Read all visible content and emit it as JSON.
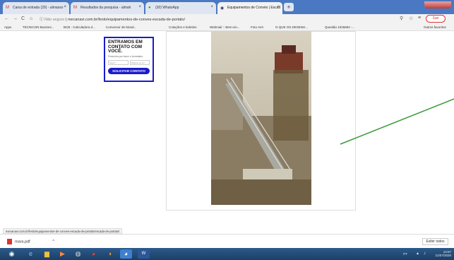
{
  "tabs": [
    {
      "label": "Caixa de entrada (29) - almasso",
      "icon": "gmail-icon"
    },
    {
      "label": "Resultados da pesquisa - almah",
      "icon": "gmail-icon"
    },
    {
      "label": "(30) WhatsApp",
      "icon": "whatsapp-icon"
    },
    {
      "label": "Equipamentos de Convés | Escad",
      "icon": "site-icon"
    }
  ],
  "address": {
    "security": "Não seguro",
    "url": "mecanavi.com.br/feslo/equipamentos-de-conves-escada-de-portalo/"
  },
  "sair_label": "Sair",
  "bookmarks": [
    "Apps",
    "TECNICON Busines...",
    "BCB - Calculadora d...",
    "Conversor de Moed...",
    "Cotações e boletins",
    "Webmail :: Bem-vin...",
    "Foto AVA",
    "O QUE OS DESENH...",
    "Questão 1026694 -...",
    "Outros favoritos"
  ],
  "contact": {
    "title": "ENTRAMOS EM CONTATO COM VOCÊ.",
    "subtitle": "Preencha por favor o formulário",
    "field1": "Nome *",
    "field2": "Telefone ou em",
    "button": "SOLICITAR CONTATO"
  },
  "status_url": "mecanavi.com.br/feslo/equipamentos-de-conves-escada-de-portalo/escada-de-portalo/",
  "download": {
    "file": "mara.pdf",
    "show_all": "Exibir todos"
  },
  "tray": {
    "lang": "PT",
    "time": "14:57",
    "date": "21/07/2020"
  },
  "colors": {
    "accent": "#1a1ac9",
    "arrow": "#3a9a3a",
    "taskbar": "#1c3f66"
  }
}
